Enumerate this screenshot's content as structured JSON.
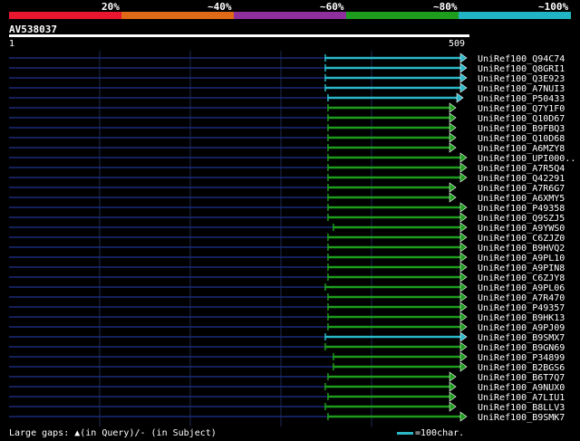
{
  "scale": {
    "labels": [
      "20%",
      "~40%",
      "~60%",
      "~80%",
      "~100%"
    ],
    "colors": [
      "#e8162f",
      "#e06a17",
      "#8f2f9d",
      "#1d9c1d",
      "#21b4c4"
    ]
  },
  "query": {
    "name": "AV538037",
    "start": "1",
    "end": "509"
  },
  "legend": {
    "gaps_text": "Large gaps: ▲(in Query)/- (in Subject)",
    "scale_text": "=100char."
  },
  "hits": [
    {
      "id": "UniRef100_Q94C74",
      "start": 352,
      "end": 509,
      "color": "cyan"
    },
    {
      "id": "UniRef100_Q8GRI1",
      "start": 352,
      "end": 509,
      "color": "cyan"
    },
    {
      "id": "UniRef100_Q3E923",
      "start": 352,
      "end": 509,
      "color": "cyan"
    },
    {
      "id": "UniRef100_A7NUI3",
      "start": 352,
      "end": 509,
      "color": "cyan"
    },
    {
      "id": "UniRef100_P50433",
      "start": 355,
      "end": 505,
      "color": "cyan"
    },
    {
      "id": "UniRef100_Q7Y1F0",
      "start": 355,
      "end": 497,
      "color": "green"
    },
    {
      "id": "UniRef100_Q10D67",
      "start": 355,
      "end": 497,
      "color": "green"
    },
    {
      "id": "UniRef100_B9FBQ3",
      "start": 355,
      "end": 497,
      "color": "green"
    },
    {
      "id": "UniRef100_Q10D68",
      "start": 355,
      "end": 497,
      "color": "green"
    },
    {
      "id": "UniRef100_A6MZY8",
      "start": 355,
      "end": 497,
      "color": "green"
    },
    {
      "id": "UniRef100_UPI000..",
      "start": 355,
      "end": 509,
      "color": "green"
    },
    {
      "id": "UniRef100_A7R5Q4",
      "start": 355,
      "end": 509,
      "color": "green"
    },
    {
      "id": "UniRef100_Q42291",
      "start": 355,
      "end": 509,
      "color": "green"
    },
    {
      "id": "UniRef100_A7R6G7",
      "start": 355,
      "end": 497,
      "color": "green"
    },
    {
      "id": "UniRef100_A6XMY5",
      "start": 355,
      "end": 497,
      "color": "green"
    },
    {
      "id": "UniRef100_P49358",
      "start": 355,
      "end": 509,
      "color": "green"
    },
    {
      "id": "UniRef100_Q9SZJ5",
      "start": 355,
      "end": 509,
      "color": "green"
    },
    {
      "id": "UniRef100_A9YWS0",
      "start": 361,
      "end": 509,
      "color": "green"
    },
    {
      "id": "UniRef100_C6ZJZ0",
      "start": 355,
      "end": 509,
      "color": "green"
    },
    {
      "id": "UniRef100_B9HVQ2",
      "start": 355,
      "end": 509,
      "color": "green"
    },
    {
      "id": "UniRef100_A9PL10",
      "start": 355,
      "end": 509,
      "color": "green"
    },
    {
      "id": "UniRef100_A9PIN8",
      "start": 355,
      "end": 509,
      "color": "green"
    },
    {
      "id": "UniRef100_C6ZJY8",
      "start": 355,
      "end": 509,
      "color": "green"
    },
    {
      "id": "UniRef100_A9PL06",
      "start": 352,
      "end": 509,
      "color": "green"
    },
    {
      "id": "UniRef100_A7R470",
      "start": 355,
      "end": 509,
      "color": "green"
    },
    {
      "id": "UniRef100_P49357",
      "start": 355,
      "end": 509,
      "color": "green"
    },
    {
      "id": "UniRef100_B9HK13",
      "start": 355,
      "end": 509,
      "color": "green"
    },
    {
      "id": "UniRef100_A9PJ09",
      "start": 355,
      "end": 509,
      "color": "green"
    },
    {
      "id": "UniRef100_B9SMX7",
      "start": 352,
      "end": 509,
      "color": "cyan"
    },
    {
      "id": "UniRef100_B9GN69",
      "start": 352,
      "end": 509,
      "color": "green"
    },
    {
      "id": "UniRef100_P34899",
      "start": 361,
      "end": 509,
      "color": "green"
    },
    {
      "id": "UniRef100_B2BGS6",
      "start": 361,
      "end": 509,
      "color": "green"
    },
    {
      "id": "UniRef100_B6T7Q7",
      "start": 355,
      "end": 497,
      "color": "green"
    },
    {
      "id": "UniRef100_A9NUX0",
      "start": 352,
      "end": 497,
      "color": "green"
    },
    {
      "id": "UniRef100_A7LIU1",
      "start": 355,
      "end": 497,
      "color": "green"
    },
    {
      "id": "UniRef100_B8LLV3",
      "start": 352,
      "end": 497,
      "color": "green"
    },
    {
      "id": "UniRef100_B9SMK7",
      "start": 355,
      "end": 509,
      "color": "green"
    }
  ]
}
